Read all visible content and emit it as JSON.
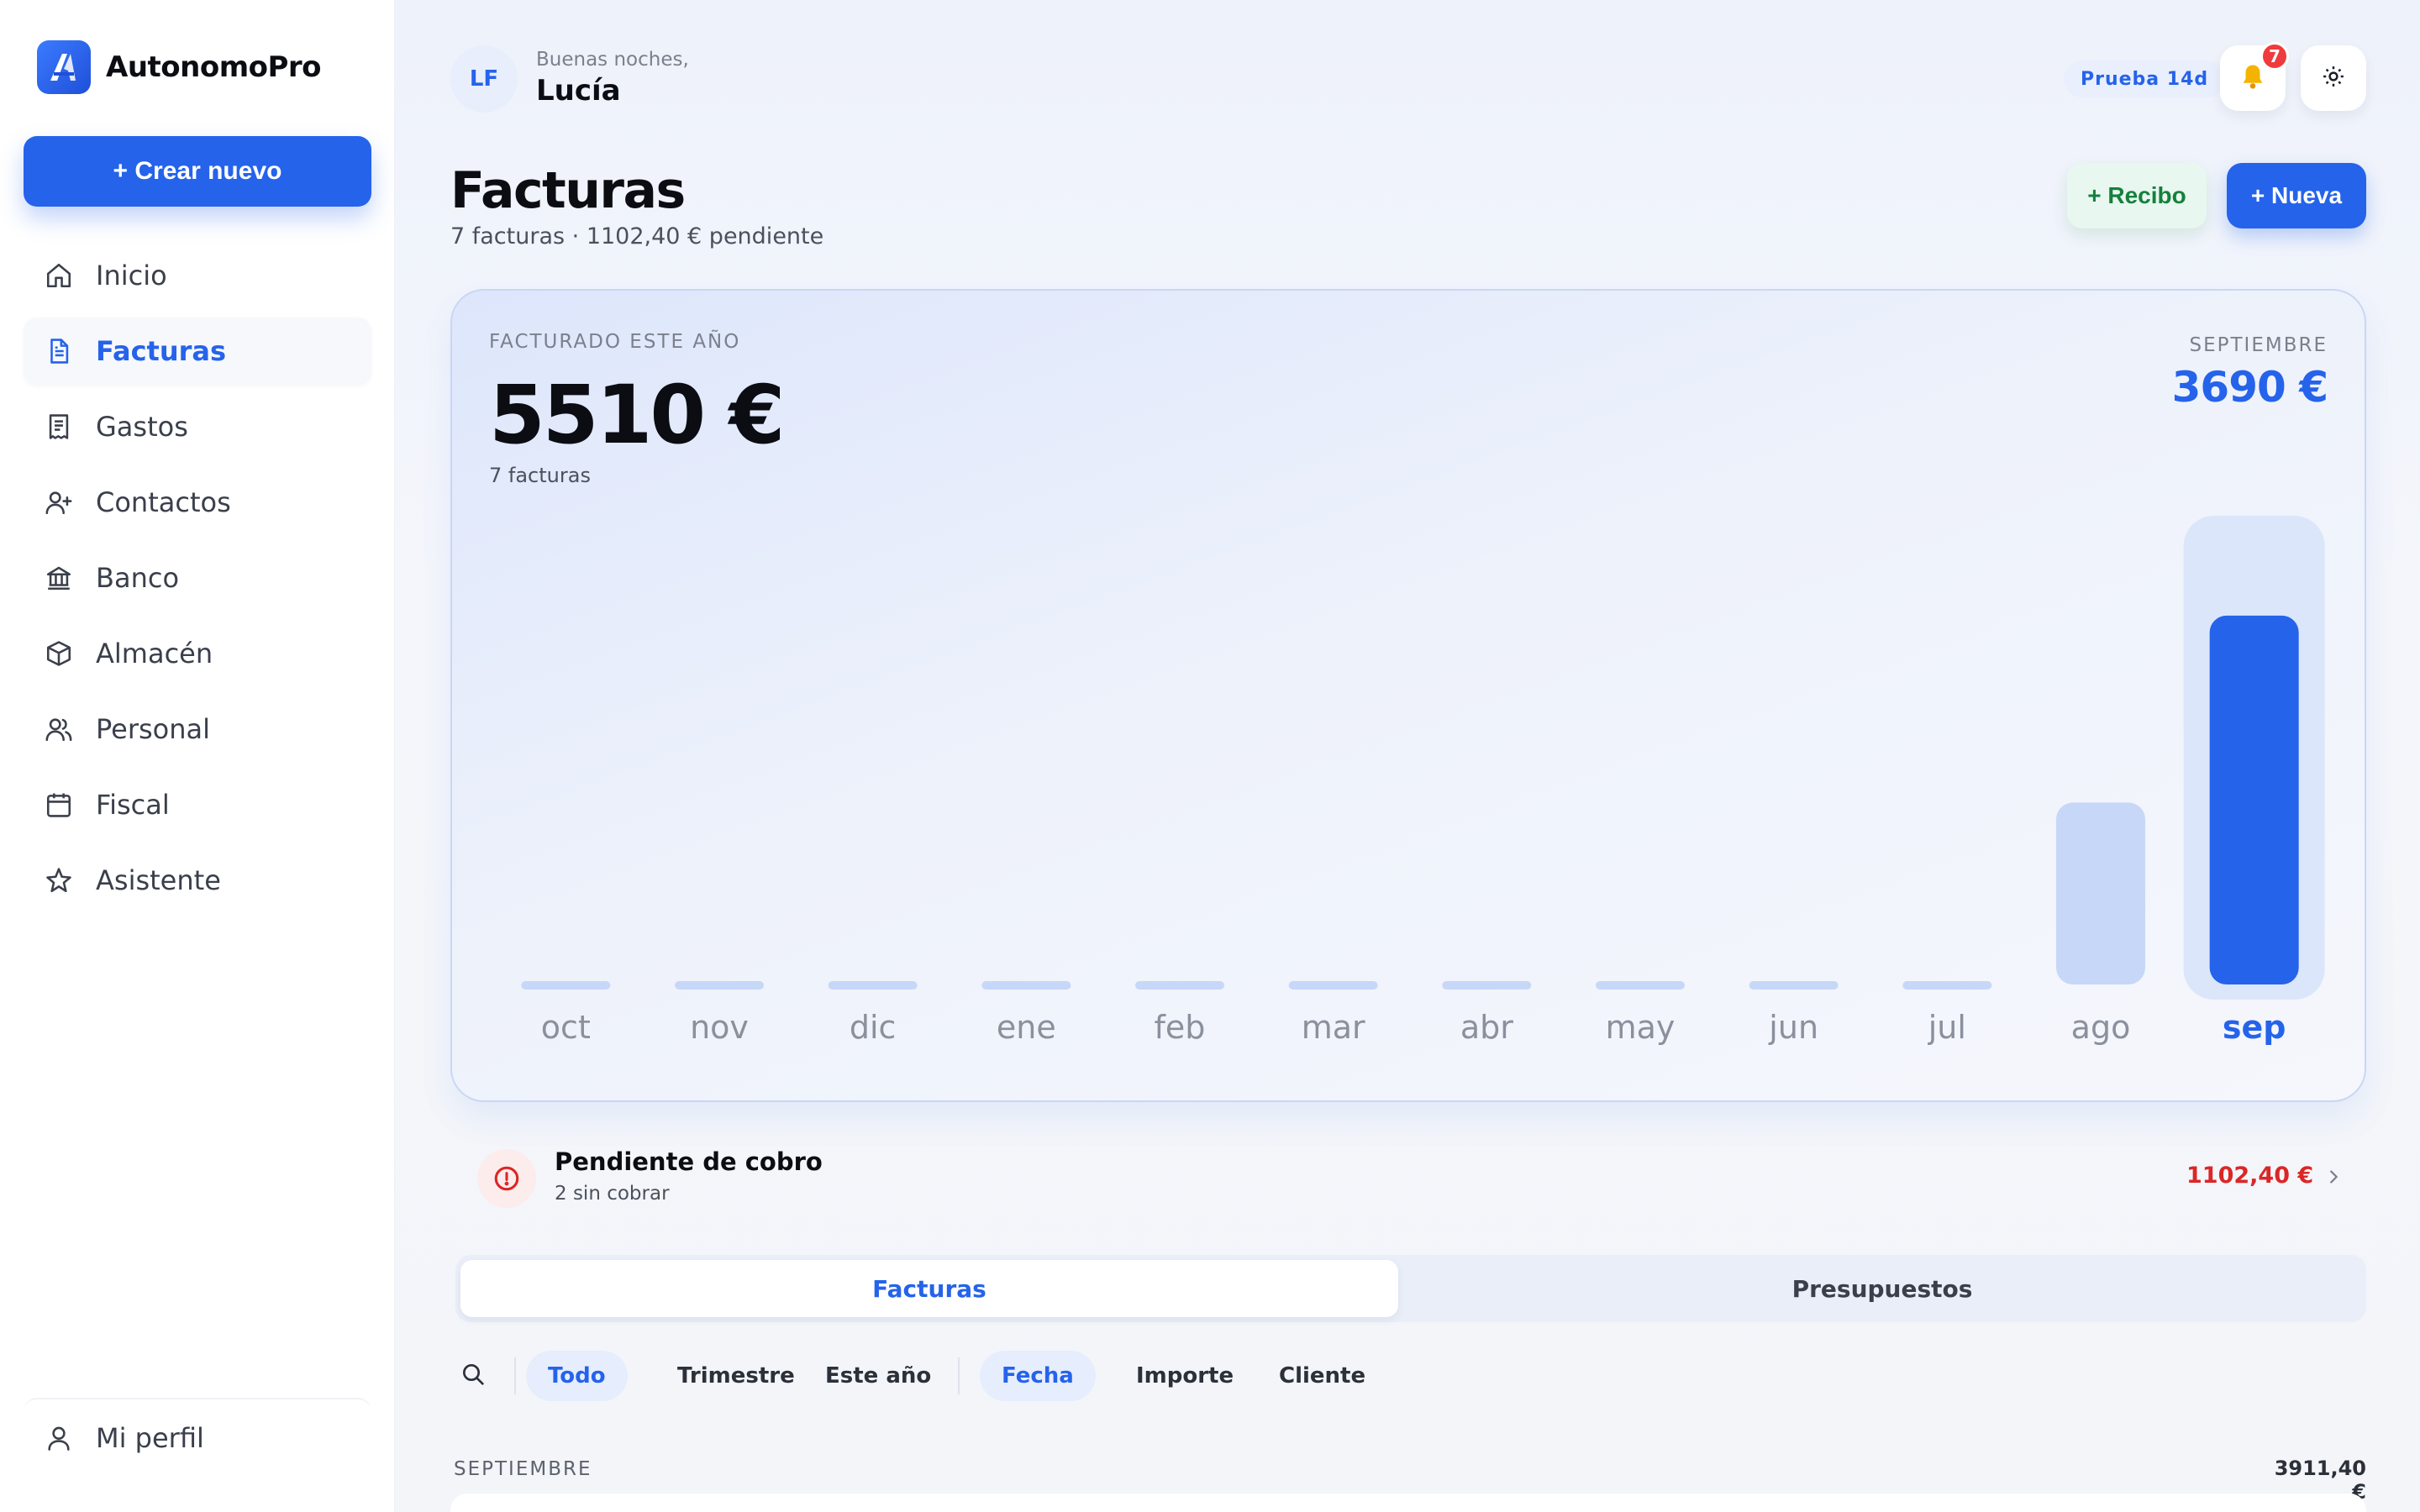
{
  "app": {
    "name": "AutonomoPro"
  },
  "sidebar": {
    "create_button": "+ Crear nuevo",
    "items": [
      {
        "label": "Inicio",
        "icon": "home-icon"
      },
      {
        "label": "Facturas",
        "icon": "document-icon",
        "active": true
      },
      {
        "label": "Gastos",
        "icon": "receipt-icon"
      },
      {
        "label": "Contactos",
        "icon": "user-plus-icon"
      },
      {
        "label": "Banco",
        "icon": "bank-icon"
      },
      {
        "label": "Almacén",
        "icon": "box-icon"
      },
      {
        "label": "Personal",
        "icon": "users-icon"
      },
      {
        "label": "Fiscal",
        "icon": "calendar-icon"
      },
      {
        "label": "Asistente",
        "icon": "sparkle-icon"
      }
    ],
    "profile": "Mi perfil"
  },
  "header": {
    "initials": "LF",
    "greeting": "Buenas noches,",
    "name": "Lucía",
    "trial": "Prueba 14d",
    "notifications": "7"
  },
  "page": {
    "title": "Facturas",
    "subtitle": "7 facturas · 1102,40 € pendiente",
    "btn_receipt": "+ Recibo",
    "btn_new": "+ Nueva"
  },
  "summary": {
    "label": "FACTURADO ESTE AÑO",
    "value": "5510 €",
    "count": "7 facturas",
    "month_label": "SEPTIEMBRE",
    "month_value": "3690 €"
  },
  "chart_data": {
    "type": "bar",
    "categories": [
      "oct",
      "nov",
      "dic",
      "ene",
      "feb",
      "mar",
      "abr",
      "may",
      "jun",
      "jul",
      "ago",
      "sep"
    ],
    "values": [
      0,
      0,
      0,
      0,
      0,
      0,
      0,
      0,
      0,
      0,
      1820,
      3690
    ],
    "highlight": "sep",
    "ylim": [
      0,
      4000
    ],
    "colors": {
      "bar": "#c7d7f7",
      "highlight": "#2563eb",
      "highlight_bg": "#dce6fa"
    }
  },
  "pending": {
    "title": "Pendiente de cobro",
    "sub": "2 sin cobrar",
    "amount": "1102,40 €"
  },
  "tabs": {
    "invoices": "Facturas",
    "quotes": "Presupuestos"
  },
  "filters": {
    "period": [
      "Todo",
      "Trimestre",
      "Este año"
    ],
    "sort": [
      "Fecha",
      "Importe",
      "Cliente"
    ]
  },
  "section": {
    "label": "SEPTIEMBRE",
    "total": "3911,40 €"
  },
  "colors": {
    "accent": "#2563eb",
    "danger": "#dc2626",
    "success": "#15803d"
  }
}
